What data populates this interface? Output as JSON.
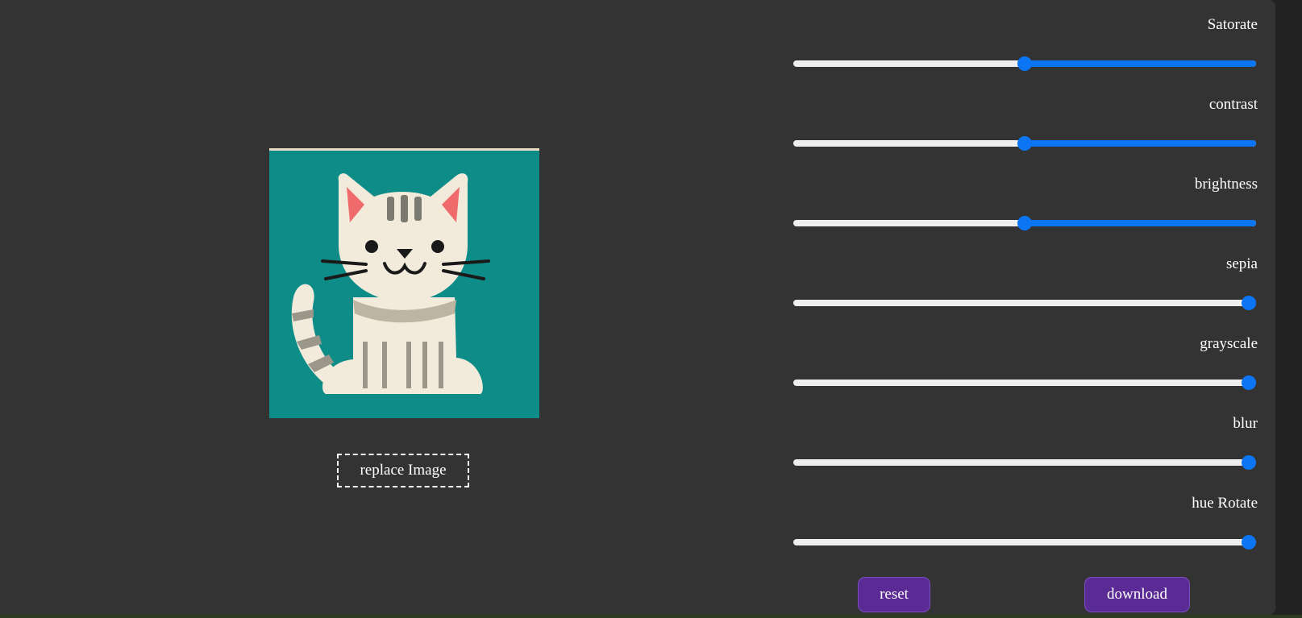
{
  "preview": {
    "image_alt": "cartoon cat",
    "replace_label": "replace Image"
  },
  "controls": [
    {
      "id": "saturate",
      "label": "Satorate",
      "value": 0.5,
      "fill_style": "right"
    },
    {
      "id": "contrast",
      "label": "contrast",
      "value": 0.5,
      "fill_style": "right"
    },
    {
      "id": "brightness",
      "label": "brightness",
      "value": 0.5,
      "fill_style": "right"
    },
    {
      "id": "sepia",
      "label": "sepia",
      "value": 1.0,
      "fill_style": "none"
    },
    {
      "id": "grayscale",
      "label": "grayscale",
      "value": 1.0,
      "fill_style": "none"
    },
    {
      "id": "blur",
      "label": "blur",
      "value": 1.0,
      "fill_style": "none"
    },
    {
      "id": "hue-rotate",
      "label": "hue Rotate",
      "value": 1.0,
      "fill_style": "none"
    }
  ],
  "actions": {
    "reset_label": "reset",
    "download_label": "download"
  },
  "colors": {
    "panel": "#333333",
    "accent": "#0b75f3",
    "button": "#5b2b95",
    "image_bg": "#0e8d88"
  }
}
